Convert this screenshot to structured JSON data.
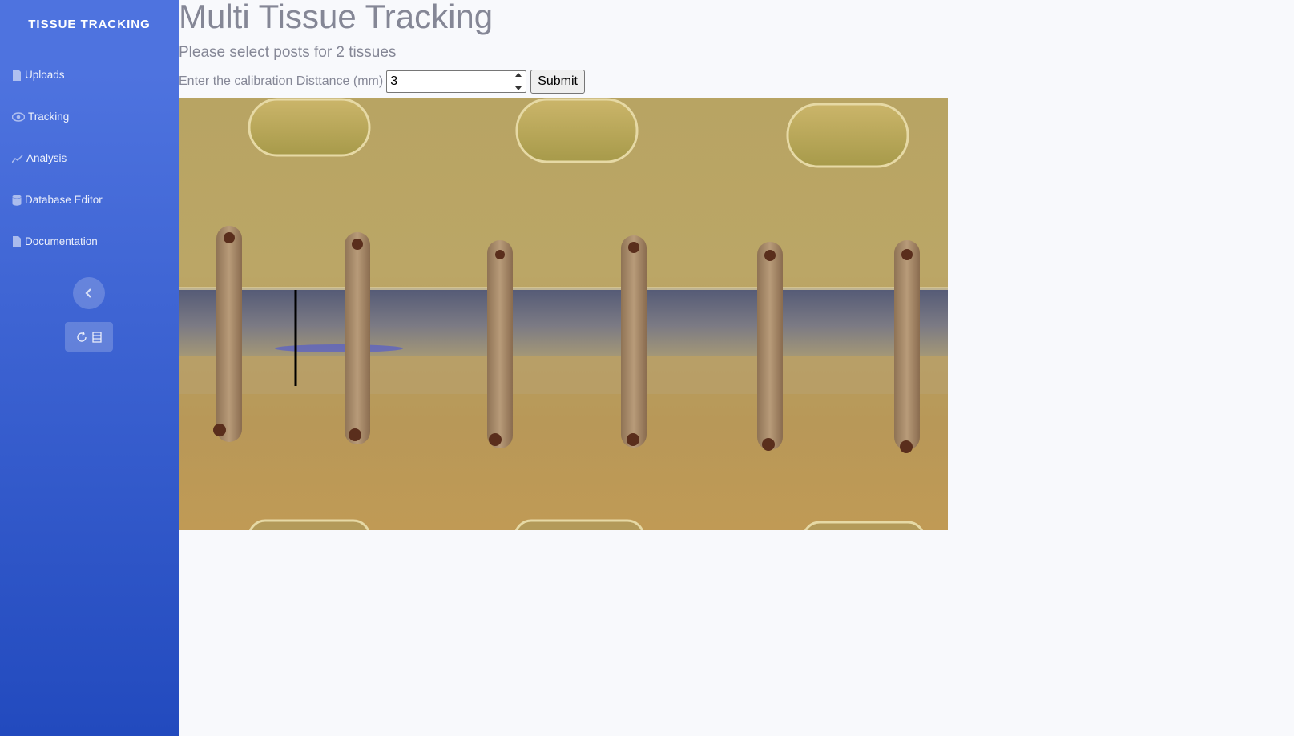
{
  "sidebar": {
    "brand": "TISSUE TRACKING",
    "items": [
      {
        "label": "Uploads",
        "icon": "file-icon"
      },
      {
        "label": "Tracking",
        "icon": "eye-icon"
      },
      {
        "label": "Analysis",
        "icon": "chart-line-icon"
      },
      {
        "label": "Database Editor",
        "icon": "database-icon"
      },
      {
        "label": "Documentation",
        "icon": "file-icon"
      }
    ],
    "toggle_icon": "chevron-left-icon",
    "tools": [
      "refresh-icon",
      "table-icon"
    ]
  },
  "main": {
    "title": "Multi Tissue Tracking",
    "subtitle": "Please select posts for 2 tissues",
    "calibration": {
      "label": "Enter the calibration Disttance (mm)",
      "value": "3"
    },
    "submit_label": "Submit"
  },
  "colors": {
    "sidebar_top": "#4e73df",
    "sidebar_bottom": "#224abe",
    "text_muted": "#858796",
    "page_bg": "#f8f9fc"
  }
}
